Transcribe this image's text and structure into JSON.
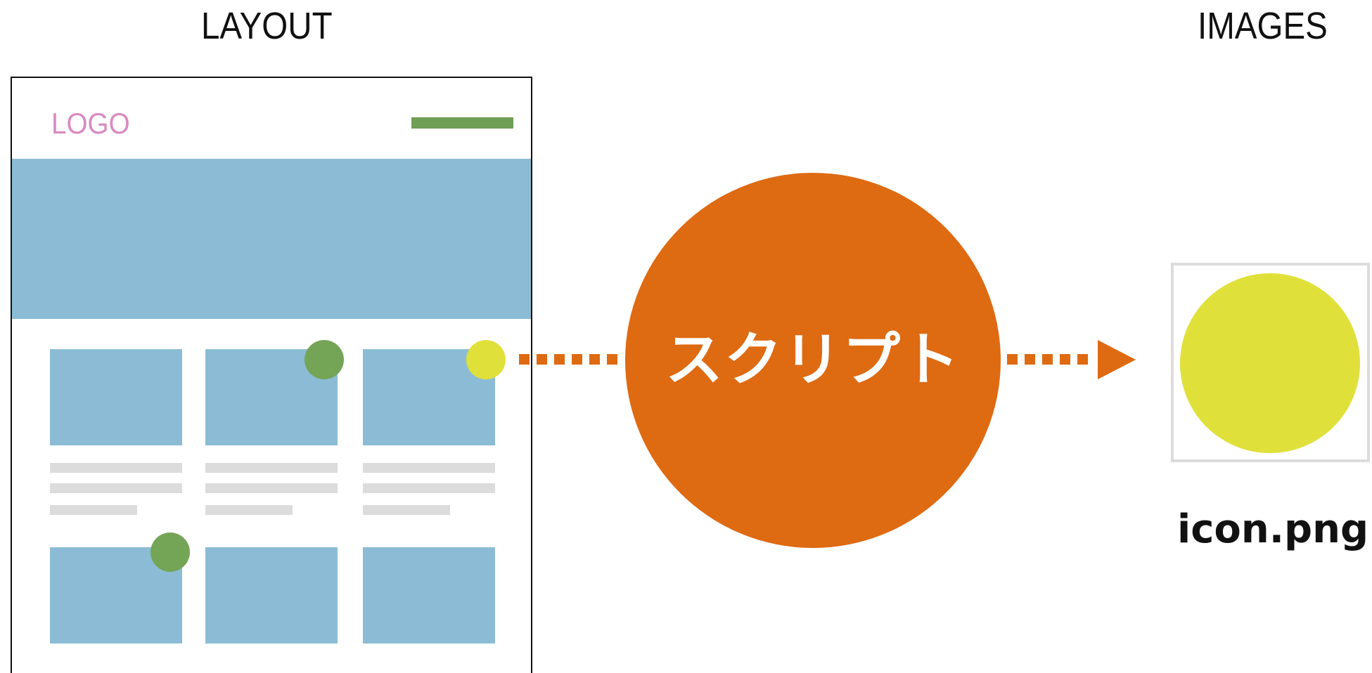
{
  "headings": {
    "layout": "LAYOUT",
    "images": "IMAGES"
  },
  "wireframe": {
    "logo": "LOGO",
    "colors": {
      "logo": "#d98ac2",
      "nav": "#6f9f55",
      "blocks": "#8cbcd5",
      "text_lines": "#dcdcdc",
      "markers_green": "#74a556",
      "marker_yellow": "#e0e03a"
    }
  },
  "process": {
    "label": "スクリプト",
    "color": "#de6a12"
  },
  "output": {
    "filename": "icon.png",
    "image_color": "#e0e03a"
  }
}
